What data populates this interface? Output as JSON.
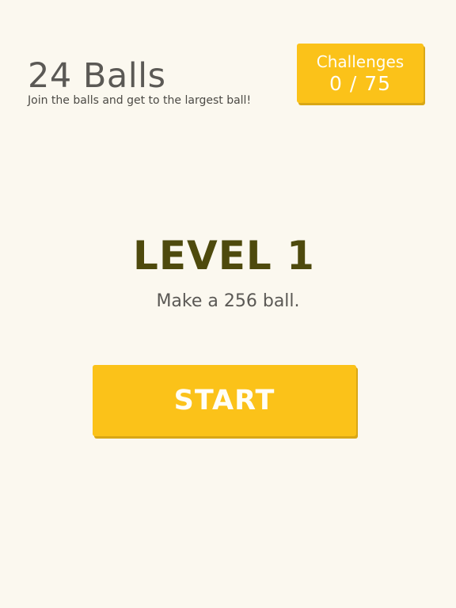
{
  "header": {
    "title": "24 Balls",
    "subtitle": "Join the balls and get to the largest ball!"
  },
  "challenges": {
    "label": "Challenges",
    "completed": 0,
    "total": 75,
    "count_text": "0 / 75"
  },
  "level": {
    "title": "LEVEL 1",
    "goal": "Make a 256 ball."
  },
  "start_button": {
    "label": "START"
  },
  "colors": {
    "background": "#fbf8ef",
    "accent": "#fbc219",
    "level_text": "#4e4a0d",
    "body_text": "#5b5955"
  }
}
